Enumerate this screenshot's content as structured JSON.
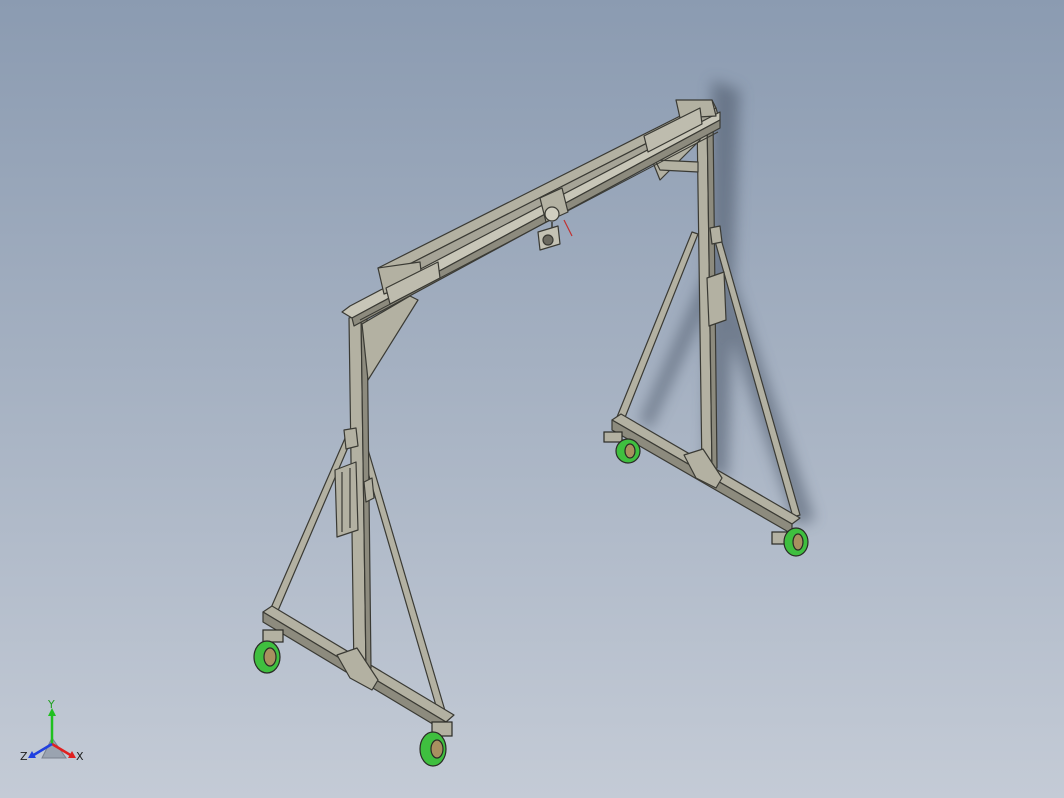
{
  "viewport": {
    "background_top": "#8b9bb1",
    "background_bottom": "#c4cbd6"
  },
  "model": {
    "frame_color": "#b3b1a2",
    "frame_edge_color": "#3a3a34",
    "wheel_color": "#3fbf3f",
    "hub_color": "#a89060",
    "shadow_color": "#4a5566"
  },
  "triad": {
    "x_label": "X",
    "y_label": "Y",
    "z_label": "Z",
    "x_color": "#e02020",
    "y_color": "#20c020",
    "z_color": "#2040e0"
  }
}
